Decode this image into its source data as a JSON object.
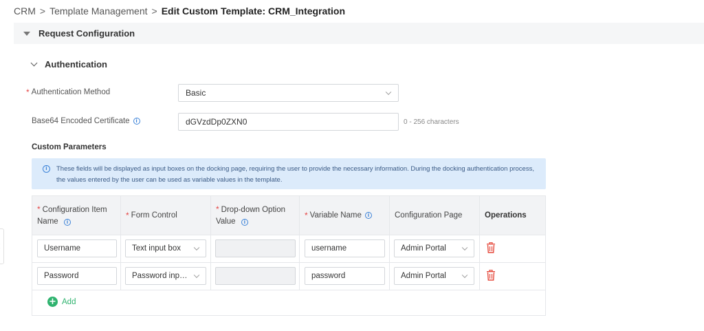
{
  "breadcrumb": {
    "items": [
      "CRM",
      "Template Management"
    ],
    "current": "Edit Custom Template: CRM_Integration",
    "separator": ">"
  },
  "request_section": {
    "title": "Request Configuration"
  },
  "auth_section": {
    "title": "Authentication",
    "method": {
      "label": "Authentication Method",
      "value": "Basic",
      "required": true
    },
    "certificate": {
      "label": "Base64 Encoded Certificate",
      "value": "dGVzdDp0ZXN0",
      "hint": "0 - 256 characters"
    }
  },
  "custom_params": {
    "title": "Custom Parameters",
    "info": "These fields will be displayed as input boxes on the docking page, requiring the user to provide the necessary information. During the docking authentication process, the values entered by the user can be used as variable values in the template.",
    "columns": {
      "config_item_name": "Configuration Item Name",
      "form_control": "Form Control",
      "dropdown_value": "Drop-down Option Value",
      "variable_name": "Variable Name",
      "config_page": "Configuration Page",
      "operations": "Operations"
    },
    "rows": [
      {
        "name": "Username",
        "form_control": "Text input box",
        "variable": "username",
        "page": "Admin Portal"
      },
      {
        "name": "Password",
        "form_control": "Password input box",
        "variable": "password",
        "page": "Admin Portal"
      }
    ],
    "add_label": "Add"
  },
  "colors": {
    "required": "#e54545",
    "accent": "#2fb36f",
    "info": "#3b82d8",
    "danger": "#e5483b"
  },
  "icons": {
    "info": "info-icon",
    "delete": "trash-icon",
    "add": "plus-circle-icon"
  }
}
